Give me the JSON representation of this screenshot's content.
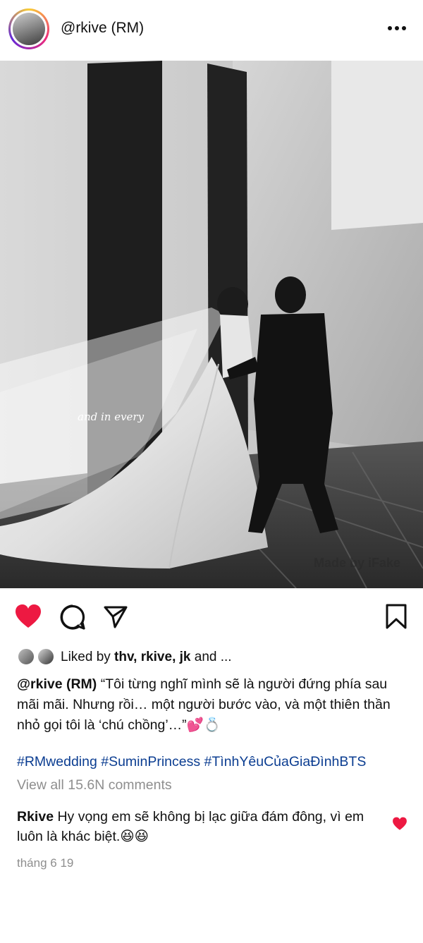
{
  "post": {
    "username": "@rkive (RM)",
    "watermark": "Made by iFake",
    "veil_script": "and in every"
  },
  "likes": {
    "prefix": "Liked by ",
    "names": "thv, rkive, jk",
    "suffix": " and ..."
  },
  "caption": {
    "username": "@rkive (RM)",
    "text": " “Tôi từng nghĩ mình sẽ là người đứng phía sau mãi mãi. Nhưng rồi… một người bước vào, và một thiên thần nhỏ gọi tôi là ‘chú chồng’…”💕💍"
  },
  "hashtags": "#RMwedding #SuminPrincess #TìnhYêuCủaGiaĐìnhBTS",
  "view_all_comments": "View all 15.6N comments",
  "comment": {
    "username": "Rkive",
    "text": " Hy vọng em sẽ không bị lạc giữa đám đông, vì em luôn là khác biệt.😆😆"
  },
  "date": "tháng 6 19",
  "colors": {
    "heart": "#ed1942",
    "hashtag": "#0b3d91",
    "muted": "#8e8e8e"
  }
}
